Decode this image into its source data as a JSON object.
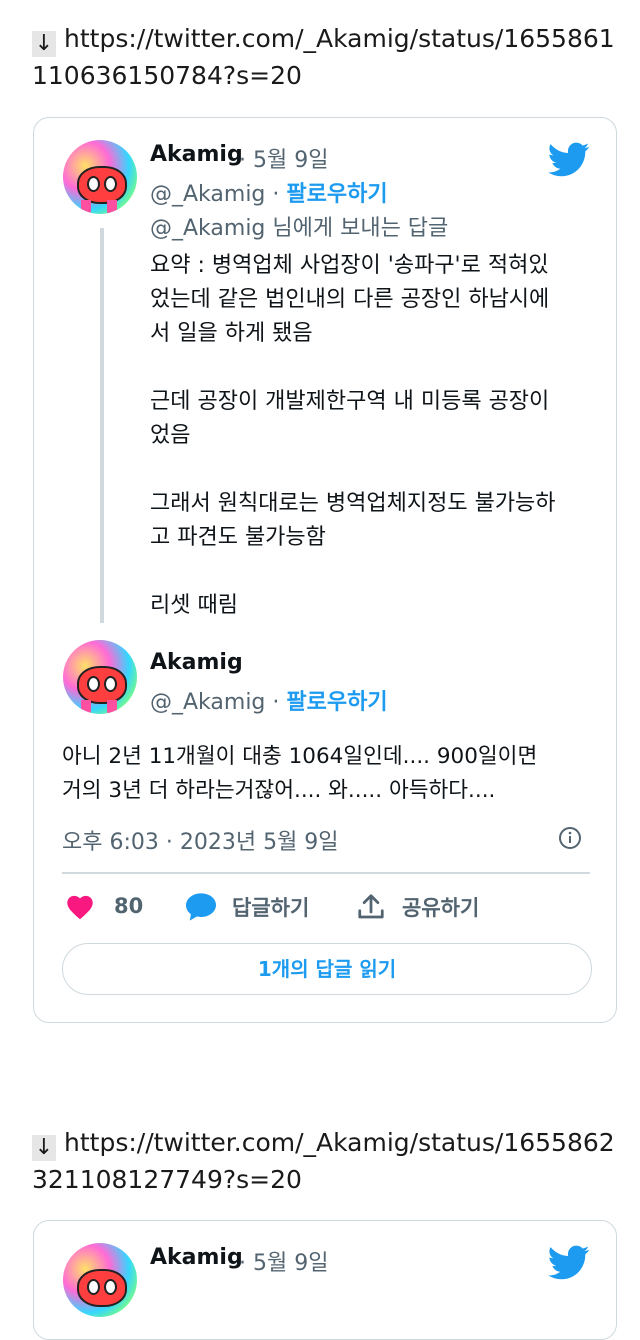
{
  "links": [
    {
      "text": "https://twitter.com/_Akamig/status/1655861110636150784?s=20"
    },
    {
      "text": "https://twitter.com/_Akamig/status/1655862321108127749?s=20"
    }
  ],
  "card1": {
    "tweet1": {
      "name": "Akamig",
      "date": "· 5월 9일",
      "handle": "@_Akamig ·",
      "follow": "팔로우하기",
      "reply_to": "@_Akamig 님에게 보내는 답글",
      "body": "요약 : 병역업체 사업장이 '송파구'로 적혀있\n었는데 같은 법인내의 다른 공장인 하남시에\n서 일을 하게 됐음\n\n근데 공장이 개발제한구역 내 미등록 공장이\n었음\n\n그래서 원칙대로는 병역업체지정도 불가능하\n고 파견도 불가능함\n\n리셋 때림"
    },
    "tweet2": {
      "name": "Akamig",
      "handle": "@_Akamig ·",
      "follow": "팔로우하기",
      "body": "아니 2년 11개월이 대충 1064일인데.... 900일이면\n거의 3년 더 하라는거잖어.... 와..... 아득하다....",
      "timestamp": "오후 6:03 · 2023년 5월 9일"
    },
    "actions": {
      "likes": "80",
      "reply_label": "답글하기",
      "share_label": "공유하기"
    },
    "read_replies": "1개의 답글 읽기"
  },
  "card2": {
    "name": "Akamig",
    "date": "· 5월 9일"
  },
  "colors": {
    "twitter_blue": "#1d9bf0",
    "like_pink": "#f91880",
    "border": "#cfd9de",
    "muted": "#536471"
  },
  "icons": [
    "down-arrow-icon",
    "twitter-bird-icon",
    "heart-icon",
    "speech-bubble-icon",
    "share-icon",
    "info-icon"
  ]
}
